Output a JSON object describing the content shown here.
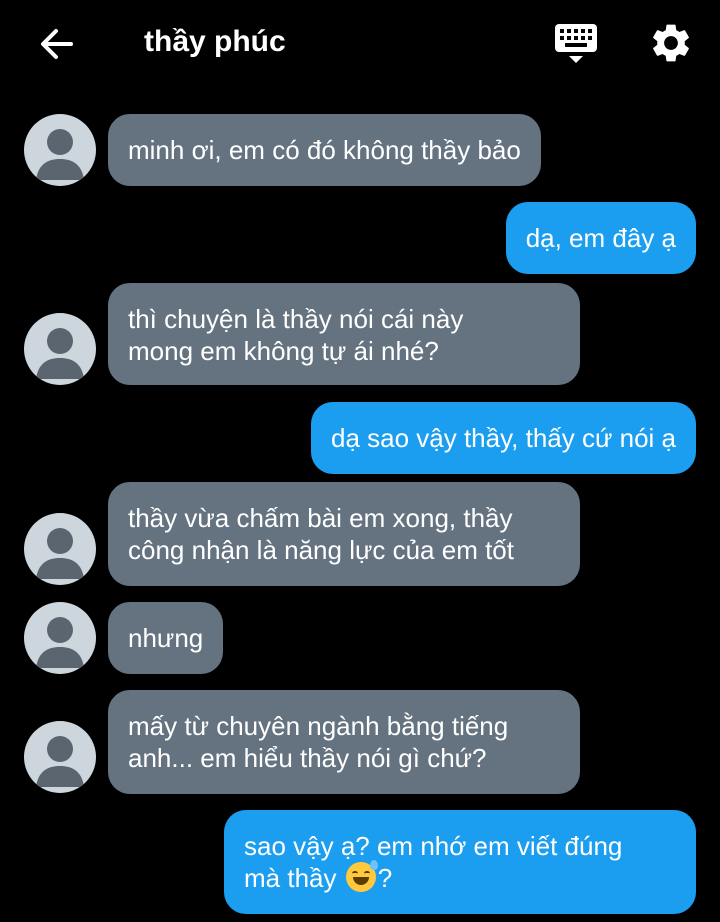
{
  "header": {
    "title": "thầy phúc",
    "back_icon": "arrow-left-icon",
    "keyboard_icon": "keyboard-icon",
    "settings_icon": "gear-icon"
  },
  "colors": {
    "background": "#000000",
    "incoming_bubble": "#65727f",
    "outgoing_bubble": "#1c9ef0",
    "avatar": "#cdd6dd"
  },
  "messages": [
    {
      "sender": "incoming",
      "lines": [
        "minh ơi, em có đó không thầy bảo"
      ]
    },
    {
      "sender": "outgoing",
      "lines": [
        "dạ, em đây ạ"
      ]
    },
    {
      "sender": "incoming",
      "lines": [
        "thì chuyện là thầy nói cái này",
        "mong em không tự ái nhé?"
      ]
    },
    {
      "sender": "outgoing",
      "lines": [
        "dạ sao vậy thầy, thấy cứ nói ạ"
      ]
    },
    {
      "sender": "incoming",
      "lines": [
        "thầy vừa chấm bài em xong, thầy",
        "công nhận là năng lực của em tốt"
      ]
    },
    {
      "sender": "incoming",
      "lines": [
        "nhưng"
      ]
    },
    {
      "sender": "incoming",
      "lines": [
        "mấy từ chuyên ngành bằng tiếng",
        "anh... em hiểu thầy nói gì chứ?"
      ]
    },
    {
      "sender": "outgoing",
      "lines": [
        "sao vậy ạ? em nhớ em viết đúng",
        "mà thầy",
        "?"
      ],
      "emoji": "grinning-sweat-emoji"
    }
  ]
}
